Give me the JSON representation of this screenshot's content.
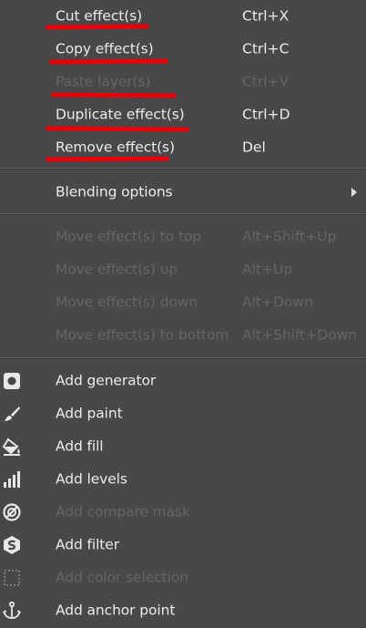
{
  "clipboard": {
    "cut": {
      "label": "Cut effect(s)",
      "shortcut": "Ctrl+X"
    },
    "copy": {
      "label": "Copy effect(s)",
      "shortcut": "Ctrl+C"
    },
    "paste": {
      "label": "Paste layer(s)",
      "shortcut": "Ctrl+V"
    },
    "duplicate": {
      "label": "Duplicate effect(s)",
      "shortcut": "Ctrl+D"
    },
    "remove": {
      "label": "Remove effect(s)",
      "shortcut": "Del"
    }
  },
  "blending": {
    "label": "Blending options"
  },
  "move": {
    "top": {
      "label": "Move effect(s) to top",
      "shortcut": "Alt+Shift+Up"
    },
    "up": {
      "label": "Move effect(s) up",
      "shortcut": "Alt+Up"
    },
    "down": {
      "label": "Move effect(s) down",
      "shortcut": "Alt+Down"
    },
    "bottom": {
      "label": "Move effect(s) to bottom",
      "shortcut": "Alt+Shift+Down"
    }
  },
  "add": {
    "generator": {
      "label": "Add generator",
      "icon": "generator-icon"
    },
    "paint": {
      "label": "Add paint",
      "icon": "brush-icon"
    },
    "fill": {
      "label": "Add fill",
      "icon": "paint-bucket-icon"
    },
    "levels": {
      "label": "Add levels",
      "icon": "levels-icon"
    },
    "compare_mask": {
      "label": "Add compare mask",
      "icon": "compare-mask-icon"
    },
    "filter": {
      "label": "Add filter",
      "icon": "filter-icon"
    },
    "color_selection": {
      "label": "Add color selection",
      "icon": "color-selection-icon"
    },
    "anchor": {
      "label": "Add anchor point",
      "icon": "anchor-icon"
    }
  },
  "colors": {
    "background": "#484848",
    "text": "#ececec",
    "disabled_text": "#656565",
    "annotation_underline": "#e8000a"
  }
}
